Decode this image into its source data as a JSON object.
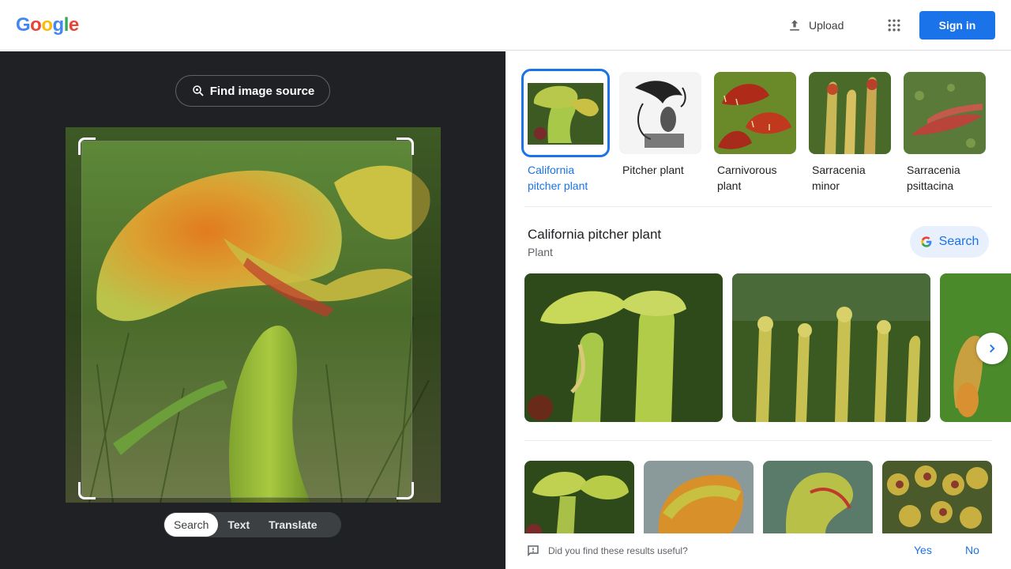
{
  "header": {
    "logo": [
      "G",
      "o",
      "o",
      "g",
      "l",
      "e"
    ],
    "upload_label": "Upload",
    "signin_label": "Sign in"
  },
  "left": {
    "find_source_label": "Find image source",
    "modes": [
      "Search",
      "Text",
      "Translate"
    ],
    "active_mode": "Search"
  },
  "related": [
    {
      "label": "California pitcher plant",
      "active": true
    },
    {
      "label": "Pitcher plant",
      "active": false
    },
    {
      "label": "Carnivorous plant",
      "active": false
    },
    {
      "label": "Sarracenia minor",
      "active": false
    },
    {
      "label": "Sarracenia psittacina",
      "active": false
    }
  ],
  "entity": {
    "title": "California pitcher plant",
    "subtitle": "Plant",
    "search_label": "Search"
  },
  "feedback": {
    "question": "Did you find these results useful?",
    "yes": "Yes",
    "no": "No"
  },
  "colors": {
    "accent": "#1a73e8",
    "dark_panel": "#202124"
  }
}
